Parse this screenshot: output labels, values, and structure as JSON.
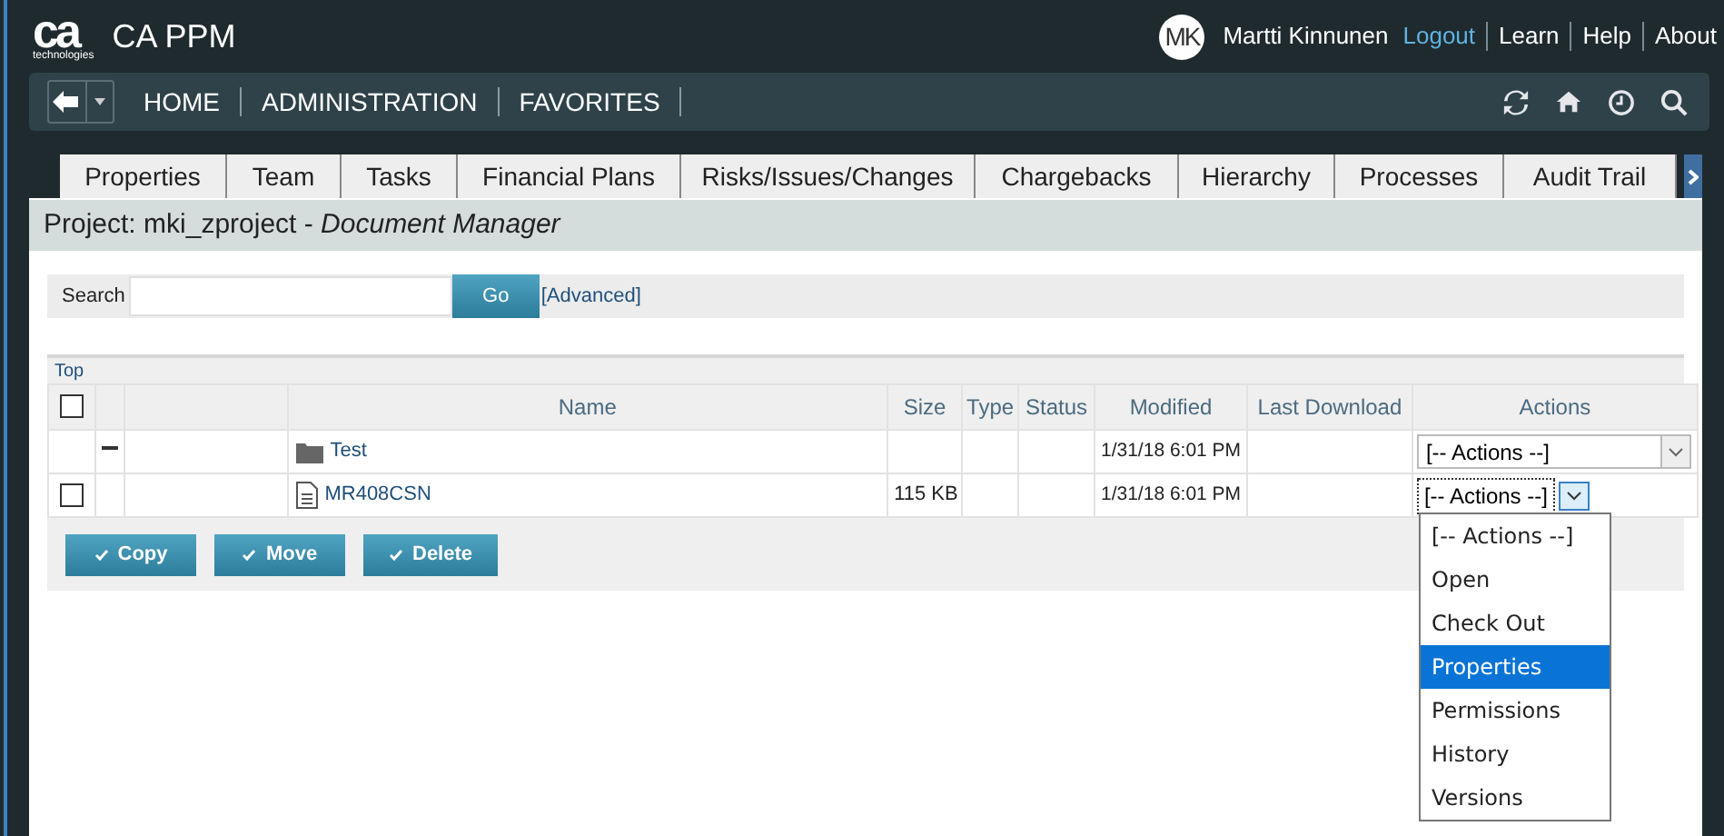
{
  "header": {
    "logo_mark": "ca",
    "logo_sub": "technologies",
    "app_title": "CA PPM",
    "avatar": "MK",
    "user_name": "Martti Kinnunen",
    "links": [
      {
        "label": "Logout",
        "kind": "accent"
      },
      {
        "label": "Learn",
        "kind": "plain"
      },
      {
        "label": "Help",
        "kind": "plain"
      },
      {
        "label": "About",
        "kind": "plain"
      }
    ]
  },
  "nav": {
    "items": [
      "HOME",
      "ADMINISTRATION",
      "FAVORITES"
    ]
  },
  "tabs": [
    {
      "label": "Properties",
      "selected": false
    },
    {
      "label": "Team",
      "selected": false
    },
    {
      "label": "Tasks",
      "selected": false
    },
    {
      "label": "Financial Plans",
      "selected": false
    },
    {
      "label": "Risks/Issues/Changes",
      "selected": false
    },
    {
      "label": "Chargebacks",
      "selected": false
    },
    {
      "label": "Hierarchy",
      "selected": false
    },
    {
      "label": "Processes",
      "selected": false
    },
    {
      "label": "Audit Trail",
      "selected": false
    }
  ],
  "page_title": "Project: mki_zproject - *Document Manager*",
  "search": {
    "label": "Search",
    "button": "Go",
    "advanced": "[Advanced]"
  },
  "table": {
    "top_link": "Top",
    "select_all_checked": false,
    "columns": [
      "Name",
      "Size",
      "Type",
      "Status",
      "Modified",
      "Last Download",
      "Actions"
    ],
    "rows": [
      {
        "kind": "folder",
        "expanded": true,
        "name": "Test",
        "modified": "1/31/18 6:01 PM",
        "action": "[-- Actions --]",
        "open": false
      },
      {
        "kind": "file",
        "checked": false,
        "name": "MR408CSN",
        "size": "115 KB",
        "modified": "1/31/18 6:01 PM",
        "action": "[-- Actions --]",
        "open": true
      }
    ],
    "buttons": [
      "Copy",
      "Move",
      "Delete"
    ]
  },
  "dropdown": {
    "options": [
      {
        "label": "[-- Actions --]",
        "selected": false
      },
      {
        "label": "Open",
        "selected": false
      },
      {
        "label": "Check Out",
        "selected": false
      },
      {
        "label": "Properties",
        "selected": true
      },
      {
        "label": "Permissions",
        "selected": false
      },
      {
        "label": "History",
        "selected": false
      },
      {
        "label": "Versions",
        "selected": false
      }
    ]
  }
}
